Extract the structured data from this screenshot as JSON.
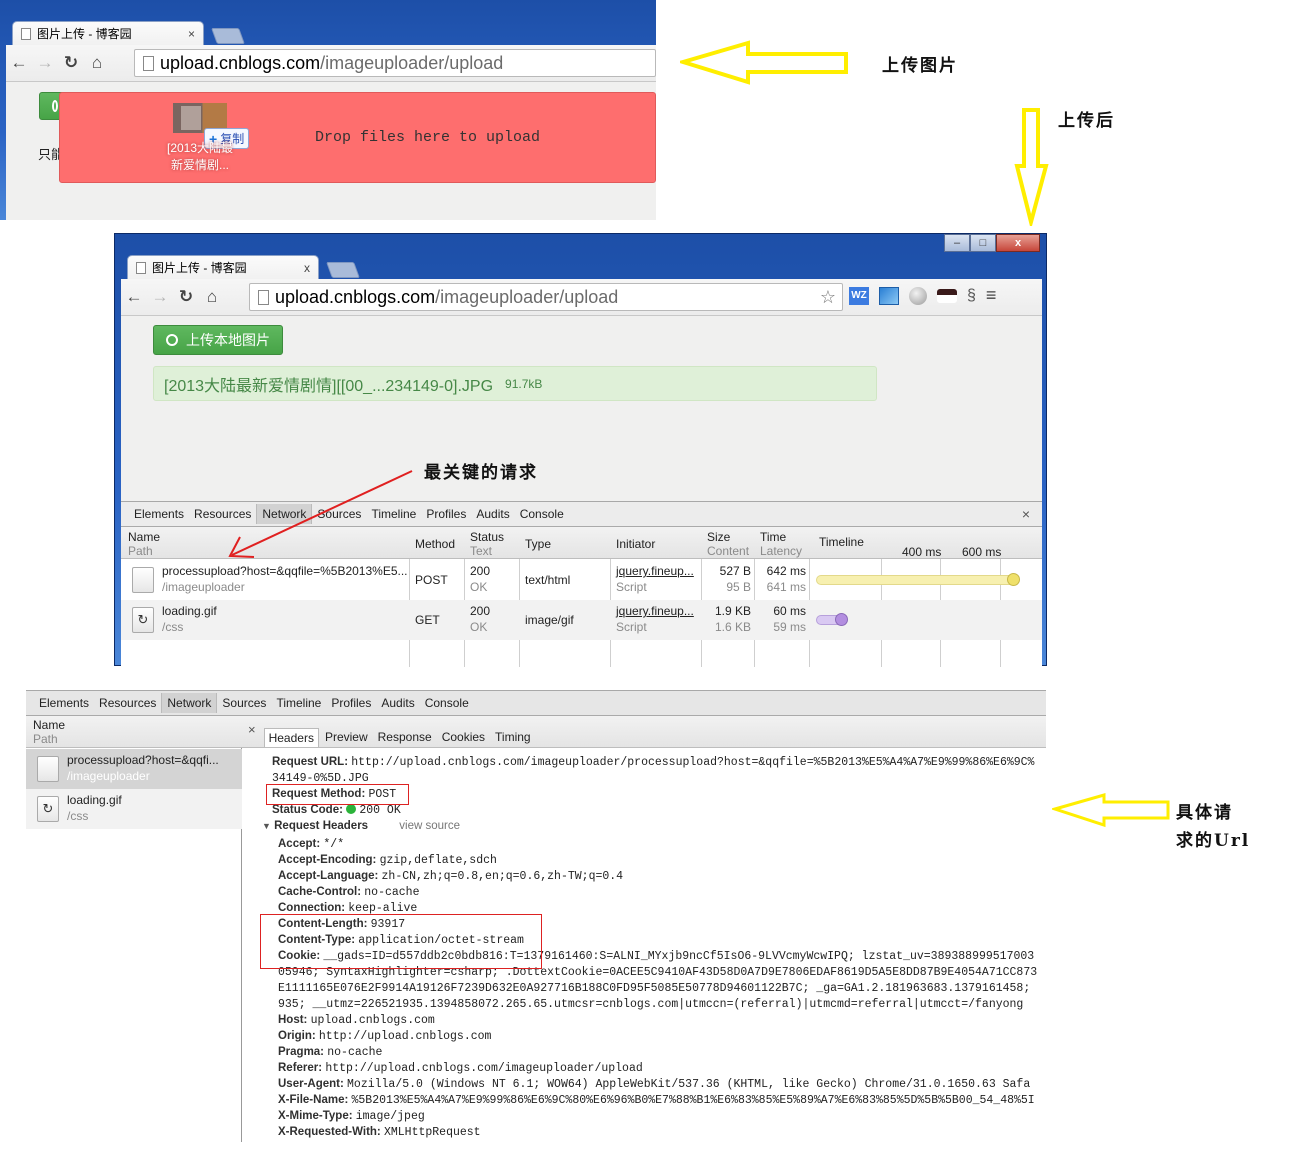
{
  "annotations": {
    "upload_image": "上传图片",
    "after_upload": "上传后",
    "key_request": "最关键的请求",
    "specific_url_line1": "具体请",
    "specific_url_line2": "求的Url"
  },
  "browser1": {
    "tab_title": "图片上传 - 博客园",
    "tab_close": "×",
    "url_host": "upload.cnblogs.com",
    "url_path": "/imageuploader/upload",
    "drop_text": "Drop files here to upload",
    "drag_copy_label": "复制",
    "drag_file_label_line1": "[2013大陆最",
    "drag_file_label_line2": "新爱情剧...",
    "hidden_text_fragment": "只能"
  },
  "browser2": {
    "tab_title": "图片上传 - 博客园",
    "tab_close": "x",
    "url_host": "upload.cnblogs.com",
    "url_path": "/imageuploader/upload",
    "upload_button": "上传本地图片",
    "uploaded_file": {
      "name": "[2013大陆最新爱情剧情][[00_...234149-0].JPG",
      "size": "91.7kB"
    },
    "extensions": [
      "star-icon",
      "wz-icon",
      "image-icon",
      "globe-icon",
      "mask-icon",
      "gecko-icon",
      "menu-icon"
    ],
    "window_controls": {
      "minimize": "–",
      "maximize": "□",
      "close": "x"
    }
  },
  "devtools": {
    "tabs": [
      "Elements",
      "Resources",
      "Network",
      "Sources",
      "Timeline",
      "Profiles",
      "Audits",
      "Console"
    ],
    "active_tab": "Network",
    "close": "×",
    "columns": {
      "name": "Name",
      "path": "Path",
      "method": "Method",
      "status": "Status",
      "status_text": "Text",
      "type": "Type",
      "initiator": "Initiator",
      "size": "Size",
      "content": "Content",
      "time": "Time",
      "latency": "Latency",
      "timeline": "Timeline",
      "tick_400": "400 ms",
      "tick_600": "600 ms"
    },
    "requests": [
      {
        "name": "processupload?host=&qqfile=%5B2013%E5...",
        "short_name": "processupload?host=&qqfi...",
        "path": "/imageuploader",
        "method": "POST",
        "status": "200",
        "status_text": "OK",
        "type": "text/html",
        "initiator": "jquery.fineup...",
        "initiator_type": "Script",
        "size": "527 B",
        "content": "95 B",
        "time": "642 ms",
        "latency": "641 ms",
        "timeline_color": "#f7ef9e"
      },
      {
        "name": "loading.gif",
        "short_name": "loading.gif",
        "path": "/css",
        "method": "GET",
        "status": "200",
        "status_text": "OK",
        "type": "image/gif",
        "initiator": "jquery.fineup...",
        "initiator_type": "Script",
        "size": "1.9 KB",
        "content": "1.6 KB",
        "time": "60 ms",
        "latency": "59 ms",
        "timeline_color": "#c9b3ea"
      }
    ]
  },
  "detail": {
    "close": "×",
    "tabs": [
      "Headers",
      "Preview",
      "Response",
      "Cookies",
      "Timing"
    ],
    "active_tab": "Headers",
    "request_url_label": "Request URL:",
    "request_url_line1": "http://upload.cnblogs.com/imageuploader/processupload?host=&qqfile=%5B2013%E5%A4%A7%E9%99%86%E6%9C%",
    "request_url_line2": "34149-0%5D.JPG",
    "request_method_label": "Request Method:",
    "request_method": "POST",
    "status_code_label": "Status Code:",
    "status_code": "200 OK",
    "request_headers_title": "Request Headers",
    "view_source": "view source",
    "headers": [
      {
        "k": "Accept:",
        "v": "*/*"
      },
      {
        "k": "Accept-Encoding:",
        "v": "gzip,deflate,sdch"
      },
      {
        "k": "Accept-Language:",
        "v": "zh-CN,zh;q=0.8,en;q=0.6,zh-TW;q=0.4"
      },
      {
        "k": "Cache-Control:",
        "v": "no-cache"
      },
      {
        "k": "Connection:",
        "v": "keep-alive"
      },
      {
        "k": "Content-Length:",
        "v": "93917"
      },
      {
        "k": "Content-Type:",
        "v": "application/octet-stream"
      },
      {
        "k": "Cookie:",
        "v": "__gads=ID=d557ddb2c0bdb816:T=1379161460:S=ALNI_MYxjb9ncCf5IsO6-9LVVcmyWcwIPQ; lzstat_uv=389388999517003"
      },
      {
        "k": "",
        "v": "05946; SyntaxHighlighter=csharp; .DottextCookie=0ACEE5C9410AF43D58D0A7D9E7806EDAF8619D5A5E8DD87B9E4054A71CC873"
      },
      {
        "k": "",
        "v": "E1111165E076E2F9914A19126F7239D632E0A927716B188C0FD95F5085E50778D94601122B7C; _ga=GA1.2.181963683.1379161458;"
      },
      {
        "k": "",
        "v": "935; __utmz=226521935.1394858072.265.65.utmcsr=cnblogs.com|utmccn=(referral)|utmcmd=referral|utmcct=/fanyong"
      },
      {
        "k": "Host:",
        "v": "upload.cnblogs.com"
      },
      {
        "k": "Origin:",
        "v": "http://upload.cnblogs.com"
      },
      {
        "k": "Pragma:",
        "v": "no-cache"
      },
      {
        "k": "Referer:",
        "v": "http://upload.cnblogs.com/imageuploader/upload"
      },
      {
        "k": "User-Agent:",
        "v": "Mozilla/5.0 (Windows NT 6.1; WOW64) AppleWebKit/537.36 (KHTML, like Gecko) Chrome/31.0.1650.63 Safa"
      },
      {
        "k": "X-File-Name:",
        "v": "%5B2013%E5%A4%A7%E9%99%86%E6%9C%80%E6%96%B0%E7%88%B1%E6%83%85%E5%89%A7%E6%83%85%5D%5B%5B00_54_48%5I"
      },
      {
        "k": "X-Mime-Type:",
        "v": "image/jpeg"
      },
      {
        "k": "X-Requested-With:",
        "v": "XMLHttpRequest"
      }
    ]
  },
  "colors": {
    "drop_zone": "#fe6e6e",
    "upload_button": "#4cae4c",
    "file_bar": "#dff0d8",
    "annotation_arrow": "#ffee00",
    "pointer_arrow": "#e02020",
    "highlight_box": "#dd2222",
    "status_ok": "#2bb33a"
  }
}
